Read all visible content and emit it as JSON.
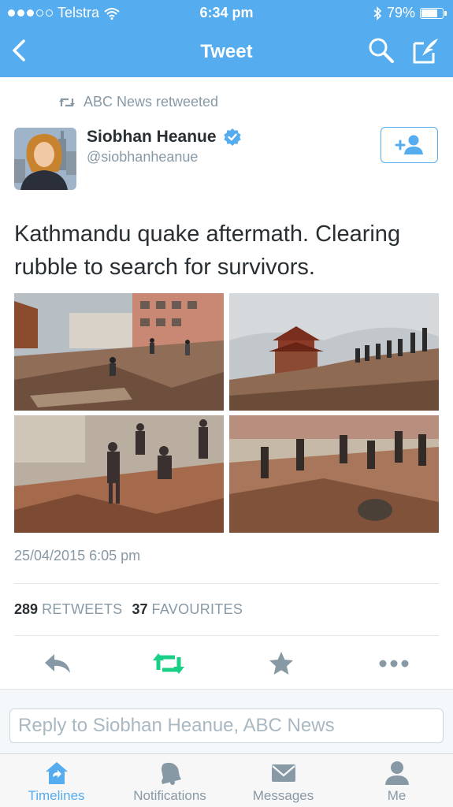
{
  "status_bar": {
    "carrier": "Telstra",
    "time": "6:34 pm",
    "battery": "79%",
    "battery_level": 0.79
  },
  "navbar": {
    "title": "Tweet"
  },
  "tweet": {
    "retweeted_by": "ABC News retweeted",
    "author_name": "Siobhan Heanue",
    "author_handle": "@siobhanheanue",
    "verified": true,
    "text": "Kathmandu quake aftermath. Clearing rubble to search for survivors.",
    "timestamp": "25/04/2015 6:05 pm",
    "retweets_count": "289",
    "retweets_label": "RETWEETS",
    "favourites_count": "37",
    "favourites_label": "FAVOURITES"
  },
  "actions": [
    "reply-icon",
    "retweet-icon",
    "favourite-icon",
    "more-icon"
  ],
  "reply": {
    "placeholder": "Reply to Siobhan Heanue, ABC News"
  },
  "tabbar": {
    "tabs": [
      {
        "label": "Timelines",
        "icon": "home-icon",
        "active": true
      },
      {
        "label": "Notifications",
        "icon": "bell-icon",
        "active": false
      },
      {
        "label": "Messages",
        "icon": "envelope-icon",
        "active": false
      },
      {
        "label": "Me",
        "icon": "person-icon",
        "active": false
      }
    ]
  },
  "colors": {
    "brand": "#55acee",
    "text": "#292f33",
    "secondary": "#8899a6",
    "retweet_green": "#19cf86",
    "icon_gray": "#8899a6"
  }
}
